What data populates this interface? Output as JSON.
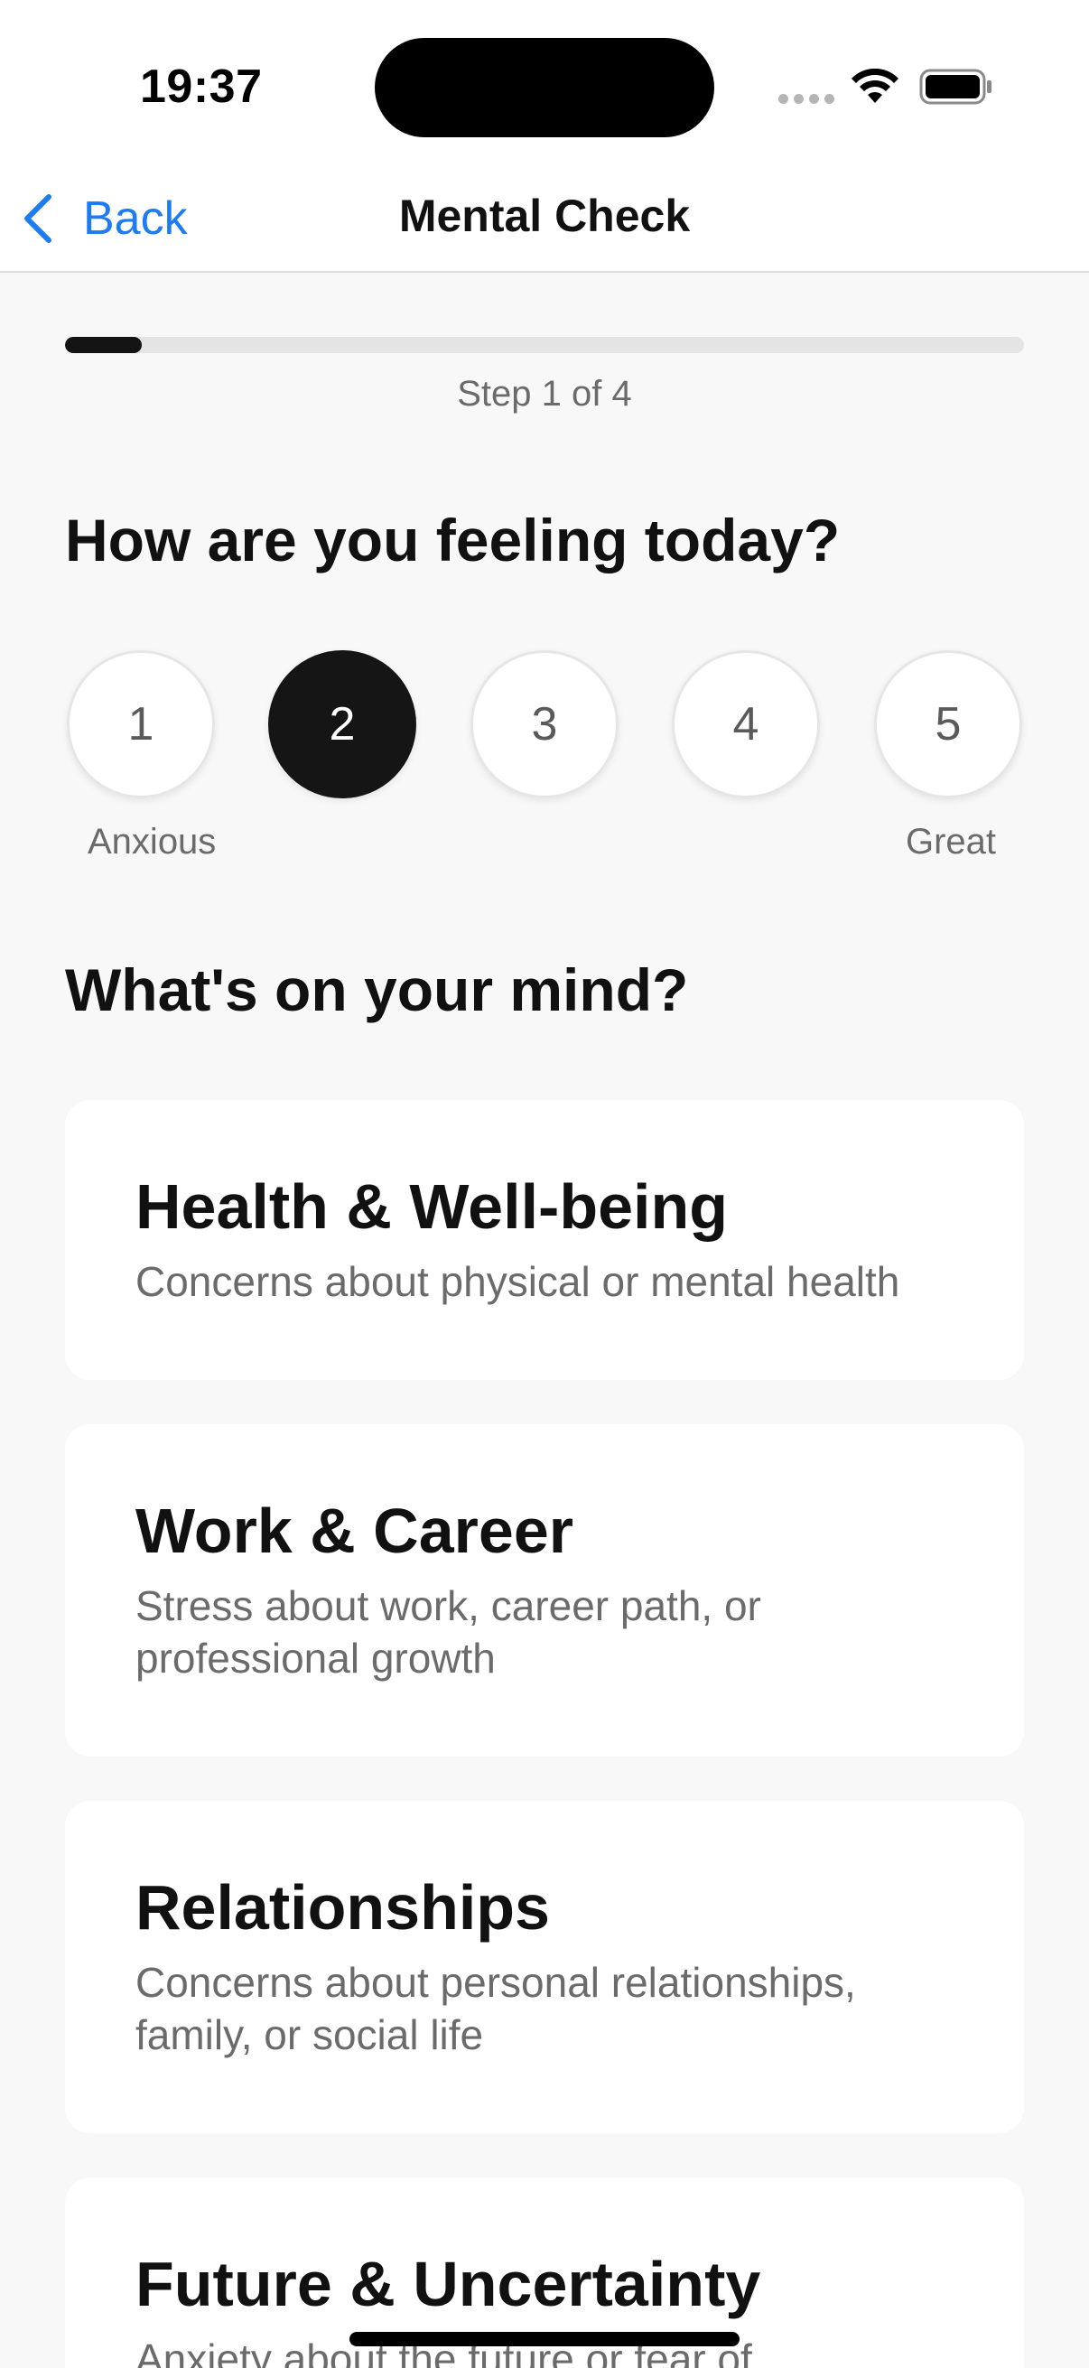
{
  "status_bar": {
    "time": "19:37"
  },
  "nav": {
    "back_label": "Back",
    "title": "Mental Check",
    "accent_color": "#1e7cf2"
  },
  "progress": {
    "fraction": 0.08,
    "step_text": "Step 1 of 4"
  },
  "mood": {
    "heading": "How are you feeling today?",
    "options": [
      "1",
      "2",
      "3",
      "4",
      "5"
    ],
    "selected": "2",
    "low_label": "Anxious",
    "high_label": "Great"
  },
  "mind": {
    "heading": "What's on your mind?",
    "categories": [
      {
        "title": "Health & Well-being",
        "description": "Concerns about physical or mental health"
      },
      {
        "title": "Work & Career",
        "description": "Stress about work, career path, or professional growth"
      },
      {
        "title": "Relationships",
        "description": "Concerns about personal relationships, family, or social life"
      },
      {
        "title": "Future & Uncertainty",
        "description": "Anxiety about the future or fear of"
      }
    ]
  }
}
